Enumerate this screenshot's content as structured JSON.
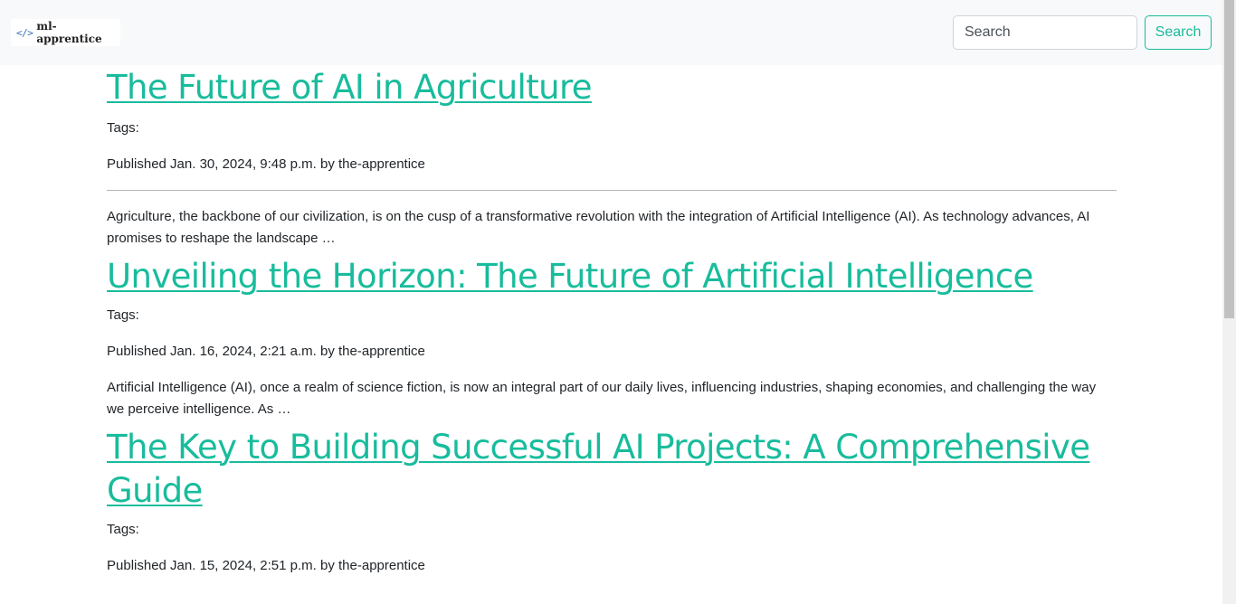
{
  "navbar": {
    "brand_icon": "</>",
    "brand_text": "ml-apprentice",
    "search_placeholder": "Search",
    "search_button": "Search"
  },
  "posts": [
    {
      "title": "The Future of AI in Agriculture",
      "tags_label": "Tags:",
      "published": "Published Jan. 30, 2024, 9:48 p.m. by the-apprentice",
      "excerpt": "Agriculture, the backbone of our civilization, is on the cusp of a transformative revolution with the integration of Artificial Intelligence (AI). As technology advances, AI promises to reshape the landscape …"
    },
    {
      "title": "Unveiling the Horizon: The Future of Artificial Intelligence",
      "tags_label": "Tags:",
      "published": "Published Jan. 16, 2024, 2:21 a.m. by the-apprentice",
      "excerpt": "Artificial Intelligence (AI), once a realm of science fiction, is now an integral part of our daily lives, influencing industries, shaping economies, and challenging the way we perceive intelligence. As …"
    },
    {
      "title": "The Key to Building Successful AI Projects: A Comprehensive Guide",
      "tags_label": "Tags:",
      "published": "Published Jan. 15, 2024, 2:51 p.m. by the-apprentice"
    }
  ],
  "colors": {
    "accent": "#18bc9c",
    "navbar_bg": "#f8f9fa",
    "text": "#212529"
  }
}
